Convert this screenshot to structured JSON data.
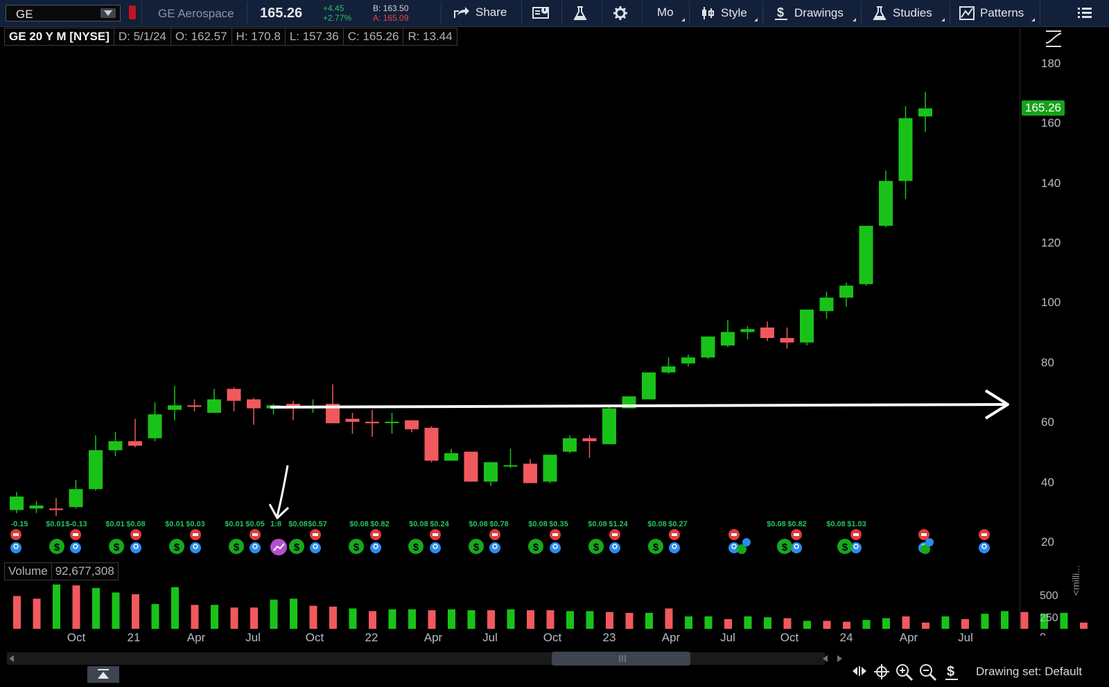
{
  "symbol": "GE",
  "company": "GE Aerospace",
  "last_price": "165.26",
  "change": "+4.45",
  "change_pct": "+2.77%",
  "bid": "B: 163.50",
  "ask": "A: 165.09",
  "toolbar": {
    "share": "Share",
    "mo": "Mo",
    "style": "Style",
    "drawings": "Drawings",
    "studies": "Studies",
    "patterns": "Patterns"
  },
  "chart_info": {
    "title": "GE 20 Y M [NYSE]",
    "date": "D: 5/1/24",
    "open": "O: 162.57",
    "high": "H: 170.8",
    "low": "L: 157.36",
    "close": "C: 165.26",
    "range": "R: 13.44"
  },
  "volume": {
    "label": "Volume",
    "value": "92,677,308",
    "unit": "<milli...",
    "ticks": [
      "500",
      "250",
      "0"
    ]
  },
  "price_axis": {
    "ticks": [
      "180",
      "160",
      "140",
      "120",
      "100",
      "80",
      "60",
      "40",
      "20"
    ],
    "last_tag": "165.26"
  },
  "x_axis": {
    "labels": [
      "Oct",
      "21",
      "Apr",
      "Jul",
      "Oct",
      "22",
      "Apr",
      "Jul",
      "Oct",
      "23",
      "Apr",
      "Jul",
      "Oct",
      "24",
      "Apr",
      "Jul"
    ]
  },
  "dividends": [
    "-0.15",
    "$0.01",
    "$-0.13",
    "$0.01",
    "$0.08",
    "$0.01",
    "$0.03",
    "$0.01",
    "$0.05",
    "1:8",
    "$0.08",
    "$0.57",
    "$0.08",
    "$0.82",
    "$0.08",
    "$0.24",
    "$0.08",
    "$0.78",
    "$0.08",
    "$0.35",
    "$0.08",
    "$1.24",
    "$0.08",
    "$0.27",
    "$0.08",
    "$0.82",
    "$0.08",
    "$1.03"
  ],
  "bottom": {
    "drawing_set": "Drawing set: Default"
  },
  "colors": {
    "up": "#19c219",
    "down": "#f0595e",
    "bg": "#000000",
    "toolbar": "#13203a",
    "price_tag": "#16a31a"
  },
  "chart_data": {
    "type": "candlestick",
    "title": "GE 20 Y M [NYSE]",
    "interval": "monthly",
    "ylim": [
      15,
      190
    ],
    "candles": [
      {
        "o": 31.0,
        "h": 37.0,
        "l": 30.0,
        "c": 35.5
      },
      {
        "o": 31.5,
        "h": 34.0,
        "l": 30.0,
        "c": 32.5
      },
      {
        "o": 31.5,
        "h": 35.0,
        "l": 29.0,
        "c": 31.0
      },
      {
        "o": 32.0,
        "h": 41.0,
        "l": 31.5,
        "c": 38.0
      },
      {
        "o": 38.0,
        "h": 56.0,
        "l": 37.5,
        "c": 51.0
      },
      {
        "o": 51.0,
        "h": 57.0,
        "l": 49.0,
        "c": 54.0
      },
      {
        "o": 54.0,
        "h": 61.5,
        "l": 52.0,
        "c": 52.5
      },
      {
        "o": 55.0,
        "h": 67.0,
        "l": 54.0,
        "c": 63.0
      },
      {
        "o": 64.5,
        "h": 72.5,
        "l": 61.0,
        "c": 66.0
      },
      {
        "o": 66.0,
        "h": 68.0,
        "l": 64.0,
        "c": 65.5
      },
      {
        "o": 63.5,
        "h": 71.5,
        "l": 63.5,
        "c": 68.0
      },
      {
        "o": 71.5,
        "h": 72.0,
        "l": 64.0,
        "c": 67.5
      },
      {
        "o": 68.0,
        "h": 68.5,
        "l": 59.5,
        "c": 65.0
      },
      {
        "o": 65.0,
        "h": 66.5,
        "l": 63.0,
        "c": 66.0
      },
      {
        "o": 66.5,
        "h": 67.5,
        "l": 61.0,
        "c": 65.5
      },
      {
        "o": 65.0,
        "h": 68.0,
        "l": 63.5,
        "c": 65.5
      },
      {
        "o": 66.5,
        "h": 73.0,
        "l": 60.0,
        "c": 60.0
      },
      {
        "o": 61.5,
        "h": 63.5,
        "l": 56.5,
        "c": 60.5
      },
      {
        "o": 60.5,
        "h": 64.5,
        "l": 55.5,
        "c": 60.0
      },
      {
        "o": 60.5,
        "h": 63.5,
        "l": 56.5,
        "c": 60.5
      },
      {
        "o": 61.0,
        "h": 61.0,
        "l": 57.0,
        "c": 58.0
      },
      {
        "o": 58.5,
        "h": 59.0,
        "l": 47.0,
        "c": 47.5
      },
      {
        "o": 47.5,
        "h": 51.5,
        "l": 47.5,
        "c": 50.0
      },
      {
        "o": 50.5,
        "h": 50.5,
        "l": 40.5,
        "c": 40.5
      },
      {
        "o": 40.5,
        "h": 47.0,
        "l": 39.0,
        "c": 47.0
      },
      {
        "o": 46.0,
        "h": 51.5,
        "l": 45.0,
        "c": 46.0
      },
      {
        "o": 46.5,
        "h": 48.0,
        "l": 40.0,
        "c": 40.0
      },
      {
        "o": 40.5,
        "h": 49.5,
        "l": 40.0,
        "c": 49.5
      },
      {
        "o": 50.5,
        "h": 56.0,
        "l": 50.0,
        "c": 55.0
      },
      {
        "o": 55.0,
        "h": 56.0,
        "l": 48.5,
        "c": 54.0
      },
      {
        "o": 53.0,
        "h": 66.0,
        "l": 53.0,
        "c": 65.0
      },
      {
        "o": 65.0,
        "h": 68.0,
        "l": 65.0,
        "c": 69.0
      },
      {
        "o": 68.0,
        "h": 77.0,
        "l": 68.0,
        "c": 77.0
      },
      {
        "o": 77.0,
        "h": 82.0,
        "l": 76.5,
        "c": 79.0
      },
      {
        "o": 80.0,
        "h": 83.0,
        "l": 79.0,
        "c": 82.0
      },
      {
        "o": 82.0,
        "h": 89.0,
        "l": 81.5,
        "c": 89.0
      },
      {
        "o": 86.0,
        "h": 94.5,
        "l": 85.5,
        "c": 90.5
      },
      {
        "o": 90.5,
        "h": 92.5,
        "l": 88.0,
        "c": 91.5
      },
      {
        "o": 92.0,
        "h": 94.0,
        "l": 87.5,
        "c": 88.5
      },
      {
        "o": 88.5,
        "h": 92.0,
        "l": 85.0,
        "c": 87.0
      },
      {
        "o": 87.0,
        "h": 98.0,
        "l": 86.0,
        "c": 98.0
      },
      {
        "o": 97.5,
        "h": 104.0,
        "l": 95.0,
        "c": 102.0
      },
      {
        "o": 102.0,
        "h": 107.0,
        "l": 99.0,
        "c": 106.0
      },
      {
        "o": 106.5,
        "h": 126.0,
        "l": 106.0,
        "c": 126.0
      },
      {
        "o": 126.0,
        "h": 144.5,
        "l": 125.5,
        "c": 141.0
      },
      {
        "o": 141.0,
        "h": 166.0,
        "l": 135.0,
        "c": 162.0
      },
      {
        "o": 162.57,
        "h": 170.8,
        "l": 157.36,
        "c": 165.26
      }
    ],
    "volume_millions": [
      370,
      340,
      500,
      490,
      460,
      410,
      390,
      280,
      470,
      270,
      270,
      240,
      240,
      330,
      340,
      260,
      250,
      230,
      200,
      220,
      220,
      210,
      220,
      210,
      210,
      220,
      210,
      210,
      200,
      200,
      190,
      180,
      180,
      230,
      140,
      140,
      110,
      140,
      130,
      120,
      90,
      90,
      80,
      100,
      120,
      140,
      70,
      140,
      110,
      170,
      200,
      190,
      170,
      180,
      70,
      0
    ]
  }
}
